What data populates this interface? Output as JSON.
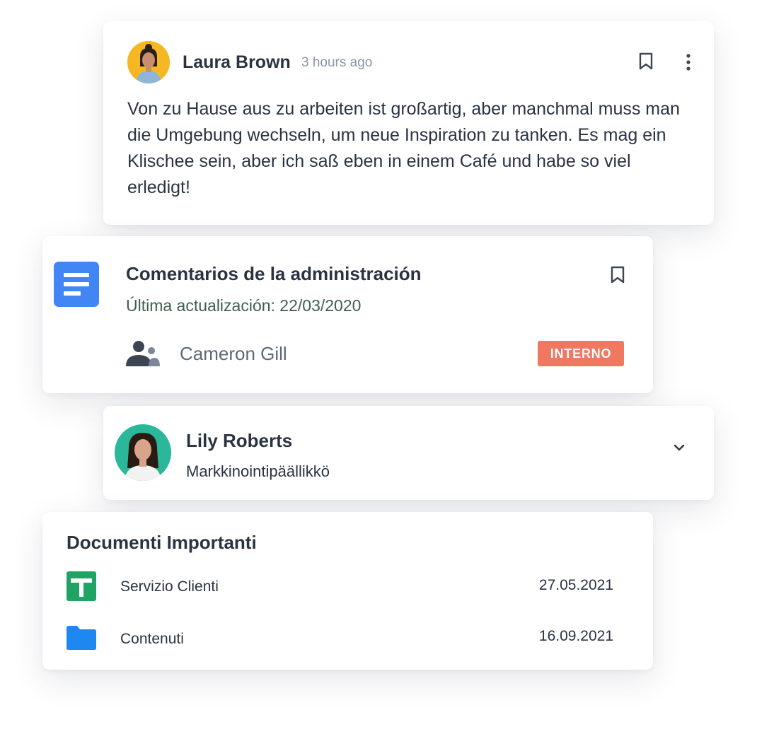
{
  "post": {
    "author": "Laura Brown",
    "time": "3 hours ago",
    "body": "Von zu Hause aus zu arbeiten ist großartig, aber manchmal muss man die Umgebung wechseln, um neue Inspiration zu tanken. Es mag ein Klischee sein, aber ich saß eben in einem Café und habe so viel erledigt!",
    "avatar_color": "#f5b823",
    "icons": [
      "bookmark-icon",
      "more-vertical-icon"
    ]
  },
  "document": {
    "title": "Comentarios de la administración",
    "subtitle": "Última actualización: 22/03/2020",
    "owner": "Cameron Gill",
    "badge": "INTERNO",
    "icon_color": "#4285f4",
    "badge_color": "#f07760",
    "icons": [
      "document-icon",
      "bookmark-icon",
      "people-icon"
    ]
  },
  "person": {
    "name": "Lily Roberts",
    "role": "Markkinointipäällikkö",
    "avatar_color": "#2bb89a",
    "icons": [
      "chevron-down-icon"
    ]
  },
  "documents": {
    "heading": "Documenti Importanti",
    "rows": [
      {
        "name": "Servizio Clienti",
        "date": "27.05.2021",
        "icon": "spreadsheet-icon",
        "color": "#1fa463"
      },
      {
        "name": "Contenuti",
        "date": "16.09.2021",
        "icon": "folder-icon",
        "color": "#1e88f0"
      }
    ]
  }
}
